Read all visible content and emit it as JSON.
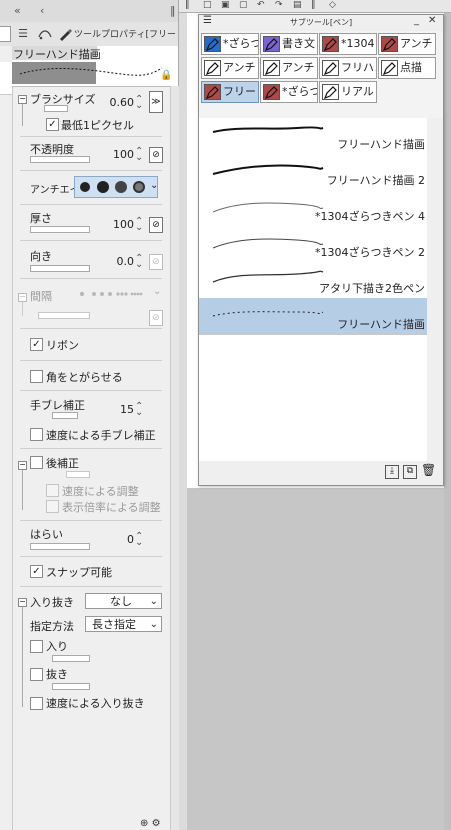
{
  "tool_property": {
    "tab_title": "ツールプロパティ[フリー",
    "brush_name": "フリーハンド描画",
    "brush_size": {
      "label": "ブラシサイズ",
      "value": "0.60"
    },
    "min_one_pixel": {
      "label": "最低1ピクセル",
      "checked": true
    },
    "opacity": {
      "label": "不透明度",
      "value": "100"
    },
    "anti_alias": {
      "label": "アンチエイリ"
    },
    "thickness": {
      "label": "厚さ",
      "value": "100"
    },
    "direction": {
      "label": "向き",
      "value": "0.0"
    },
    "interval": {
      "label": "間隔"
    },
    "ribbon": {
      "label": "リボン",
      "checked": true
    },
    "sharp_corners": {
      "label": "角をとがらせる",
      "checked": false
    },
    "stabilization": {
      "label": "手ブレ補正",
      "value": "15"
    },
    "speed_stabilization": {
      "label": "速度による手ブレ補正",
      "checked": false
    },
    "post_correction": {
      "label": "後補正",
      "checked": false
    },
    "speed_adjust": {
      "label": "速度による調整"
    },
    "zoom_adjust": {
      "label": "表示倍率による調整"
    },
    "sweep": {
      "label": "はらい",
      "value": "0"
    },
    "snap": {
      "label": "スナップ可能",
      "checked": true
    },
    "taper": {
      "label": "入り抜き",
      "value": "なし"
    },
    "spec_method": {
      "label": "指定方法",
      "value": "長さ指定"
    },
    "taper_in": {
      "label": "入り"
    },
    "taper_out": {
      "label": "抜き"
    },
    "speed_taper": {
      "label": "速度による入り抜き"
    }
  },
  "subtool": {
    "title": "サブツール[ペン]",
    "tabs": [
      {
        "label": "*ざらつ",
        "icon": "pen-nib-icon",
        "color": "#1f6fd0"
      },
      {
        "label": "書き文",
        "icon": "pen-nib-icon",
        "color": "#7b63d6"
      },
      {
        "label": "*1304",
        "icon": "pen-nib-icon",
        "color": "#b04848"
      },
      {
        "label": "アンチ",
        "icon": "pen-nib-icon",
        "color": "#b04848"
      },
      {
        "label": "アンチ",
        "icon": "pen-nib-icon",
        "color": "#ffffff"
      },
      {
        "label": "アンチ",
        "icon": "pen-nib-icon",
        "color": "#ffffff"
      },
      {
        "label": "フリハン",
        "icon": "pen-nib-icon",
        "color": "#ffffff"
      },
      {
        "label": "点描",
        "icon": "pen-nib-icon",
        "color": "#ffffff"
      },
      {
        "label": "フリー",
        "icon": "pen-nib-icon",
        "color": "#b04848"
      },
      {
        "label": "*ざらつ",
        "icon": "pen-nib-icon",
        "color": "#b04848"
      },
      {
        "label": "リアル",
        "icon": "pen-nib-icon",
        "color": "#ffffff"
      }
    ],
    "brushes": [
      {
        "name": "フリーハンド描画",
        "selected": false
      },
      {
        "name": "フリーハンド描画 2",
        "selected": false
      },
      {
        "name": "*1304ざらつきペン 4",
        "selected": false
      },
      {
        "name": "*1304ざらつきペン 2",
        "selected": false
      },
      {
        "name": "アタリ下描き2色ペン",
        "selected": false
      },
      {
        "name": "フリーハンド描画",
        "selected": true
      }
    ]
  },
  "colors": {
    "selection": "#b6cde6",
    "active_tab": "#bcd3ea",
    "panel_bg": "#efefef"
  }
}
